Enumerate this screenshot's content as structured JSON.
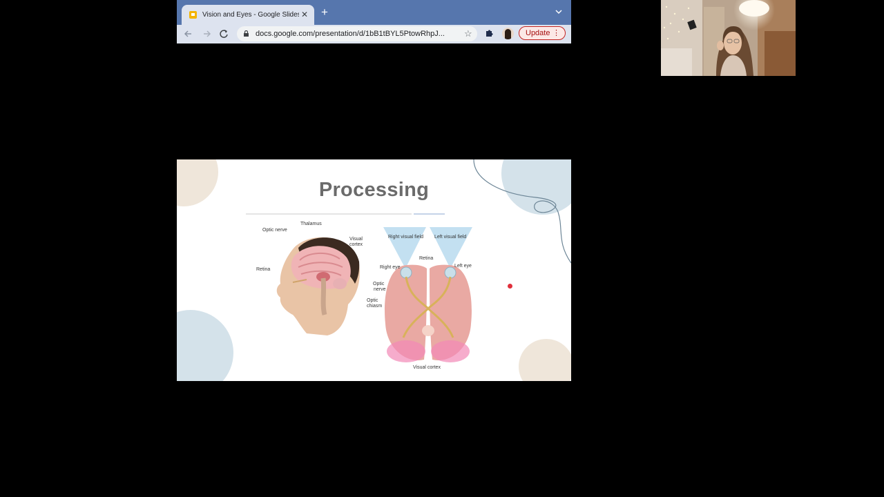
{
  "browser": {
    "tab_title": "Vision and Eyes - Google Slides",
    "url": "docs.google.com/presentation/d/1bB1tBYL5PtowRhpJ...",
    "update_label": "Update",
    "new_tab_symbol": "+",
    "close_symbol": "✕",
    "menu_symbol": "⋮"
  },
  "slide": {
    "title": "Processing",
    "head_labels": {
      "optic_nerve": "Optic nerve",
      "thalamus": "Thalamus",
      "visual_cortex_1": "Visual",
      "visual_cortex_2": "cortex",
      "retina": "Retina"
    },
    "brain_labels": {
      "right_visual_field": "Right visual field",
      "left_visual_field": "Left visual field",
      "right_eye": "Right eye",
      "left_eye": "Left eye",
      "retina": "Retina",
      "optic_nerve_1": "Optic",
      "optic_nerve_2": "nerve",
      "optic_chiasm_1": "Optic",
      "optic_chiasm_2": "chiasm",
      "visual_cortex": "Visual cortex"
    }
  },
  "colors": {
    "tabstrip": "#5676ad",
    "toolbar": "#dde3ef",
    "update_border": "#c5221f",
    "pointer": "#e0303c",
    "blob_beige": "#efe6da",
    "blob_blue": "#d4e2ea"
  }
}
